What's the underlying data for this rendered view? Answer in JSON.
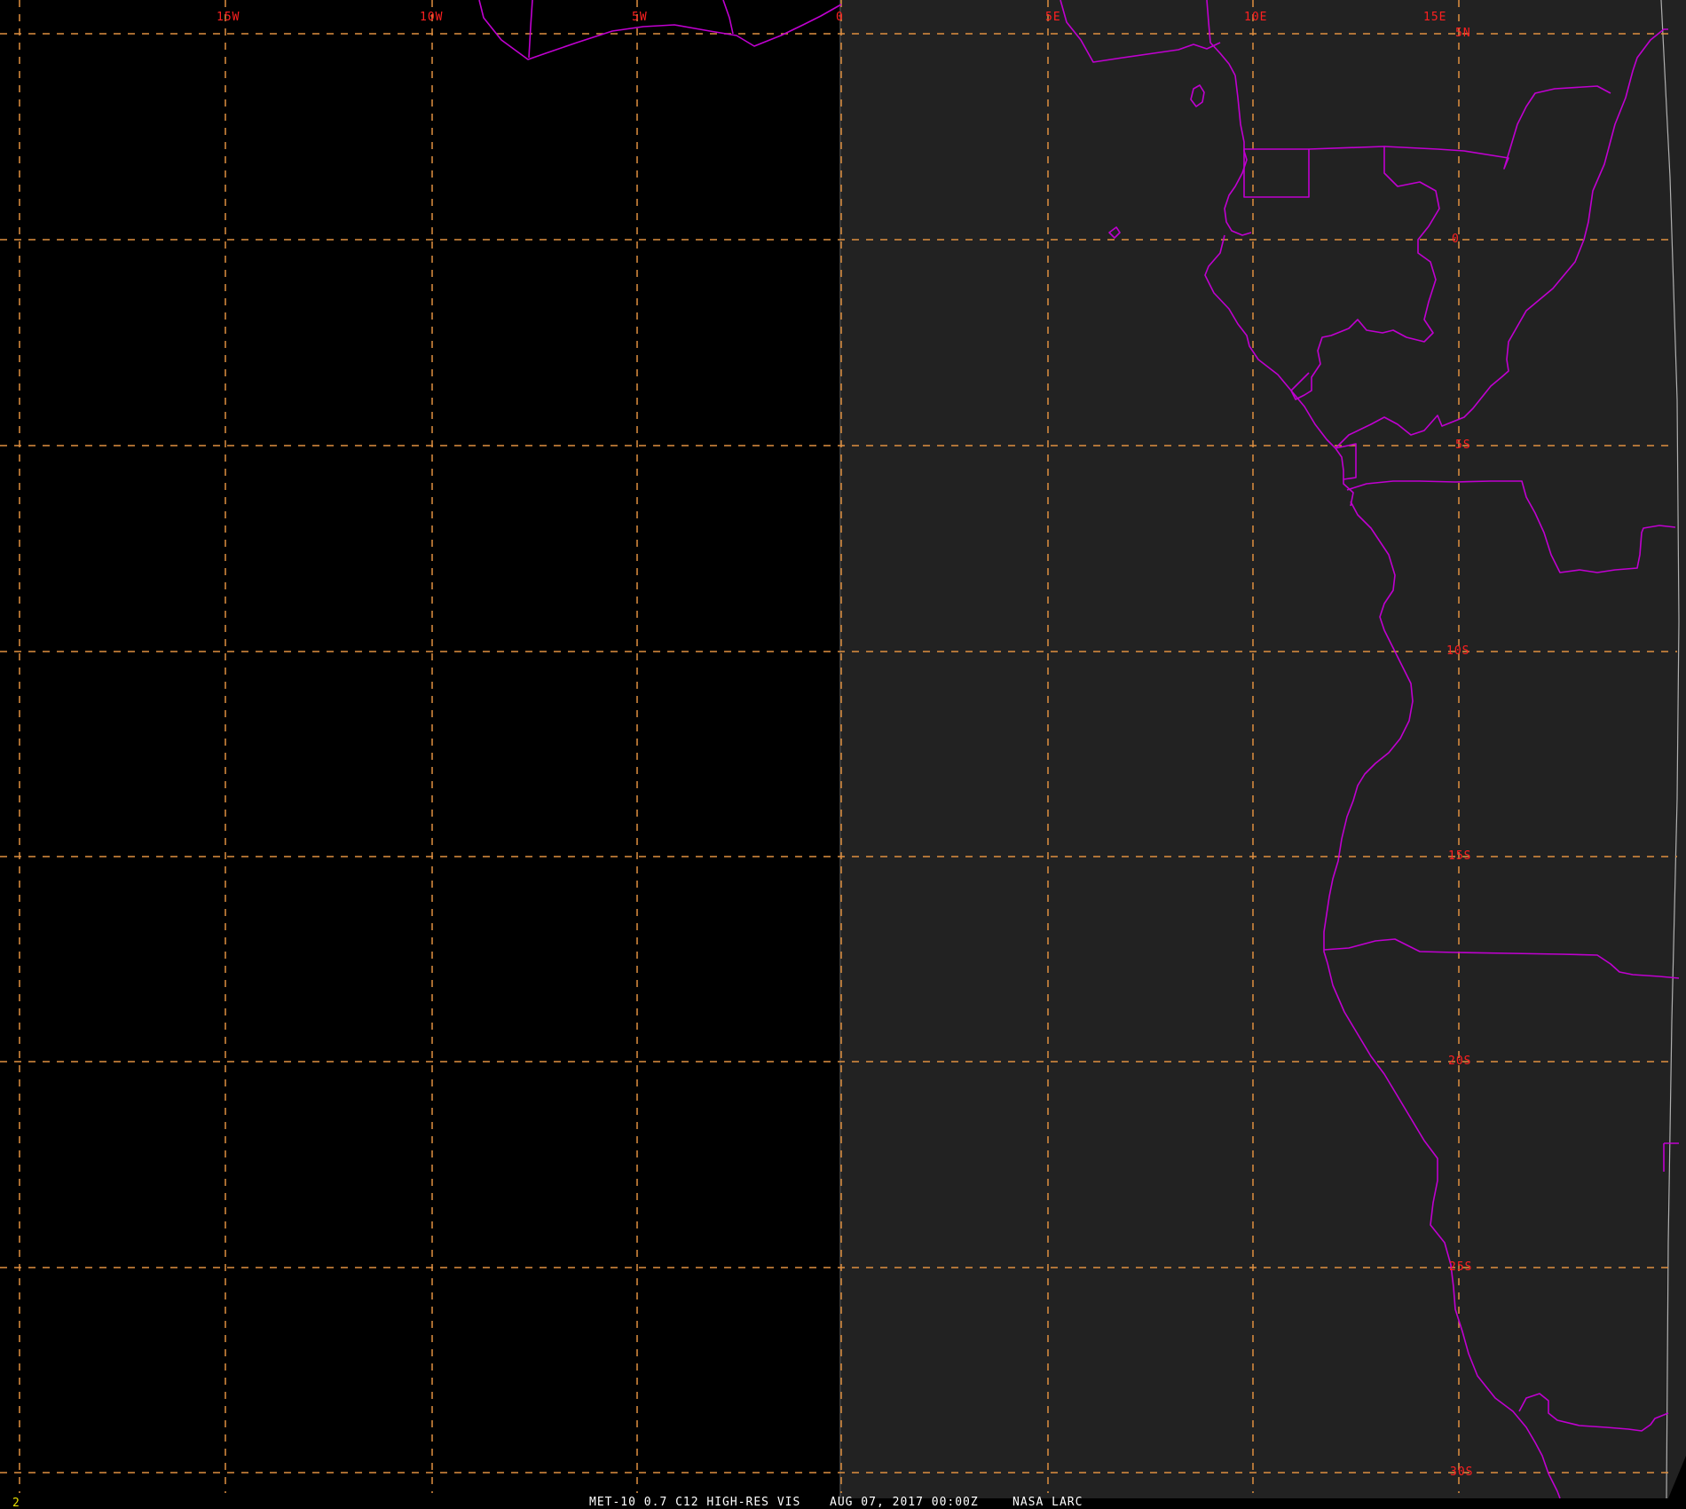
{
  "colors": {
    "background": "#000000",
    "imagery_day_side": "#222222",
    "gridlines": "#e09040",
    "grid_labels": "#ff2020",
    "boundaries": "#c000d0",
    "status_text": "#ffffff",
    "frame_number": "#e8e000"
  },
  "map": {
    "longitude_labels": [
      "15W",
      "10W",
      "5W",
      "0",
      "5E",
      "10E",
      "15E"
    ],
    "latitude_labels": [
      "5N",
      "0",
      "5S",
      "10S",
      "15S",
      "20S",
      "25S",
      "30S"
    ],
    "grid_style": "dashed"
  },
  "status_bar": {
    "frame_number": "2",
    "product": "MET-10 0.7 C12 HIGH-RES VIS",
    "datetime": "AUG 07, 2017 00:00Z",
    "source": "NASA LARC"
  }
}
